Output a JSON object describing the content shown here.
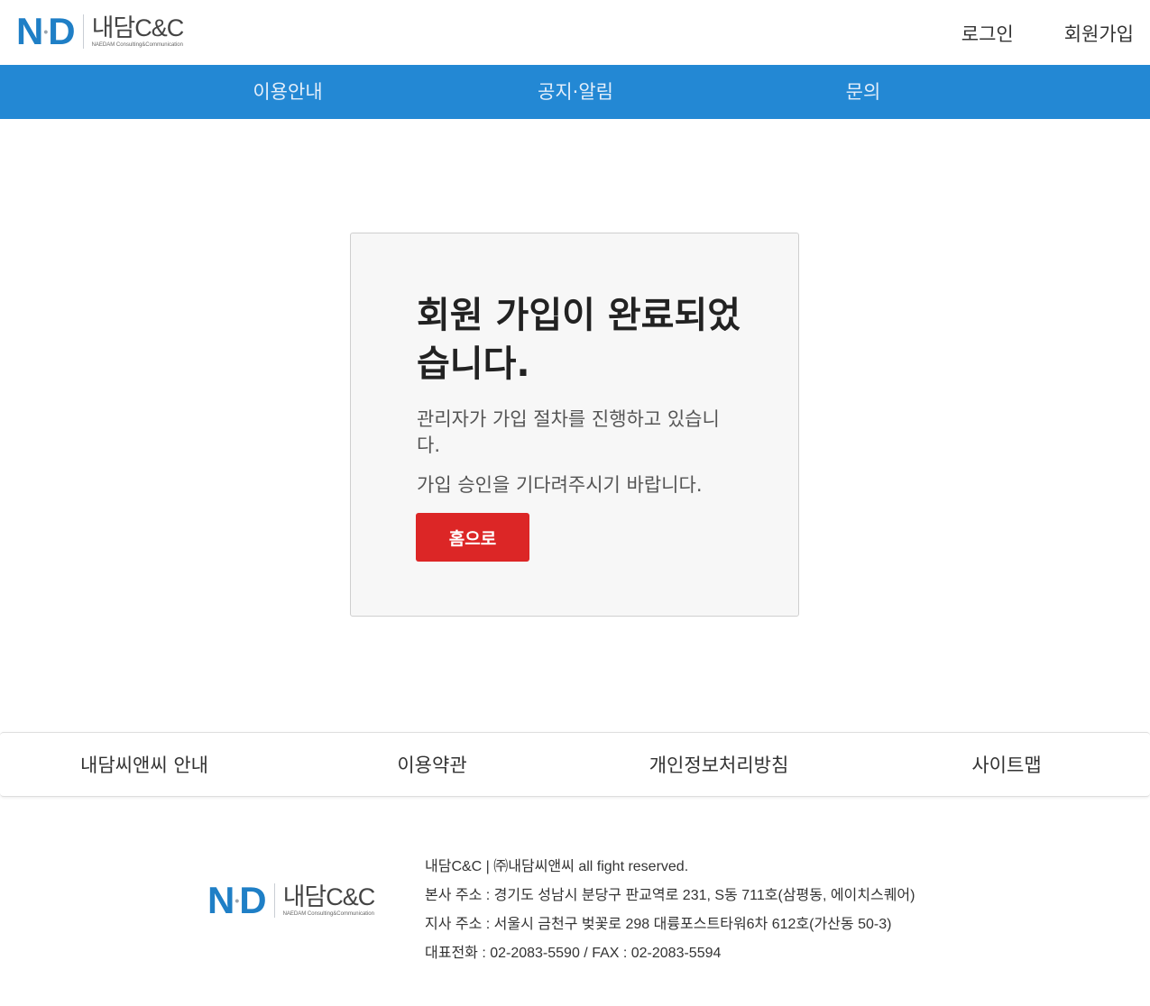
{
  "header": {
    "logo": {
      "mark_left": "N",
      "mark_right": "D",
      "name": "내담C&C",
      "tagline": "NAEDAM Consulting&Communication"
    },
    "login": "로그인",
    "signup": "회원가입"
  },
  "nav": {
    "items": [
      "이용안내",
      "공지·알림",
      "문의"
    ]
  },
  "card": {
    "title": "회원 가입이 완료되었습니다.",
    "message1": "관리자가 가입 절차를 진행하고 있습니다.",
    "message2": "가입 승인을 기다려주시기 바랍니다.",
    "button": "홈으로"
  },
  "footer": {
    "links": [
      "내담씨앤씨 안내",
      "이용약관",
      "개인정보처리방침",
      "사이트맵"
    ],
    "logo": {
      "mark_left": "N",
      "mark_right": "D",
      "name": "내담C&C",
      "tagline": "NAEDAM Consulting&Communication"
    },
    "info": [
      "내담C&C | ㈜내담씨앤씨 all fight reserved.",
      "본사 주소 : 경기도 성남시 분당구 판교역로 231, S동 711호(삼평동, 에이치스퀘어)",
      "지사 주소 : 서울시 금천구 벚꽃로 298 대륭포스트타워6차 612호(가산동 50-3)",
      "대표전화 : 02-2083-5590 / FAX : 02-2083-5594"
    ]
  },
  "colors": {
    "brand_blue": "#2388d4",
    "button_red": "#dc2626",
    "card_bg": "#f7f7f7"
  }
}
